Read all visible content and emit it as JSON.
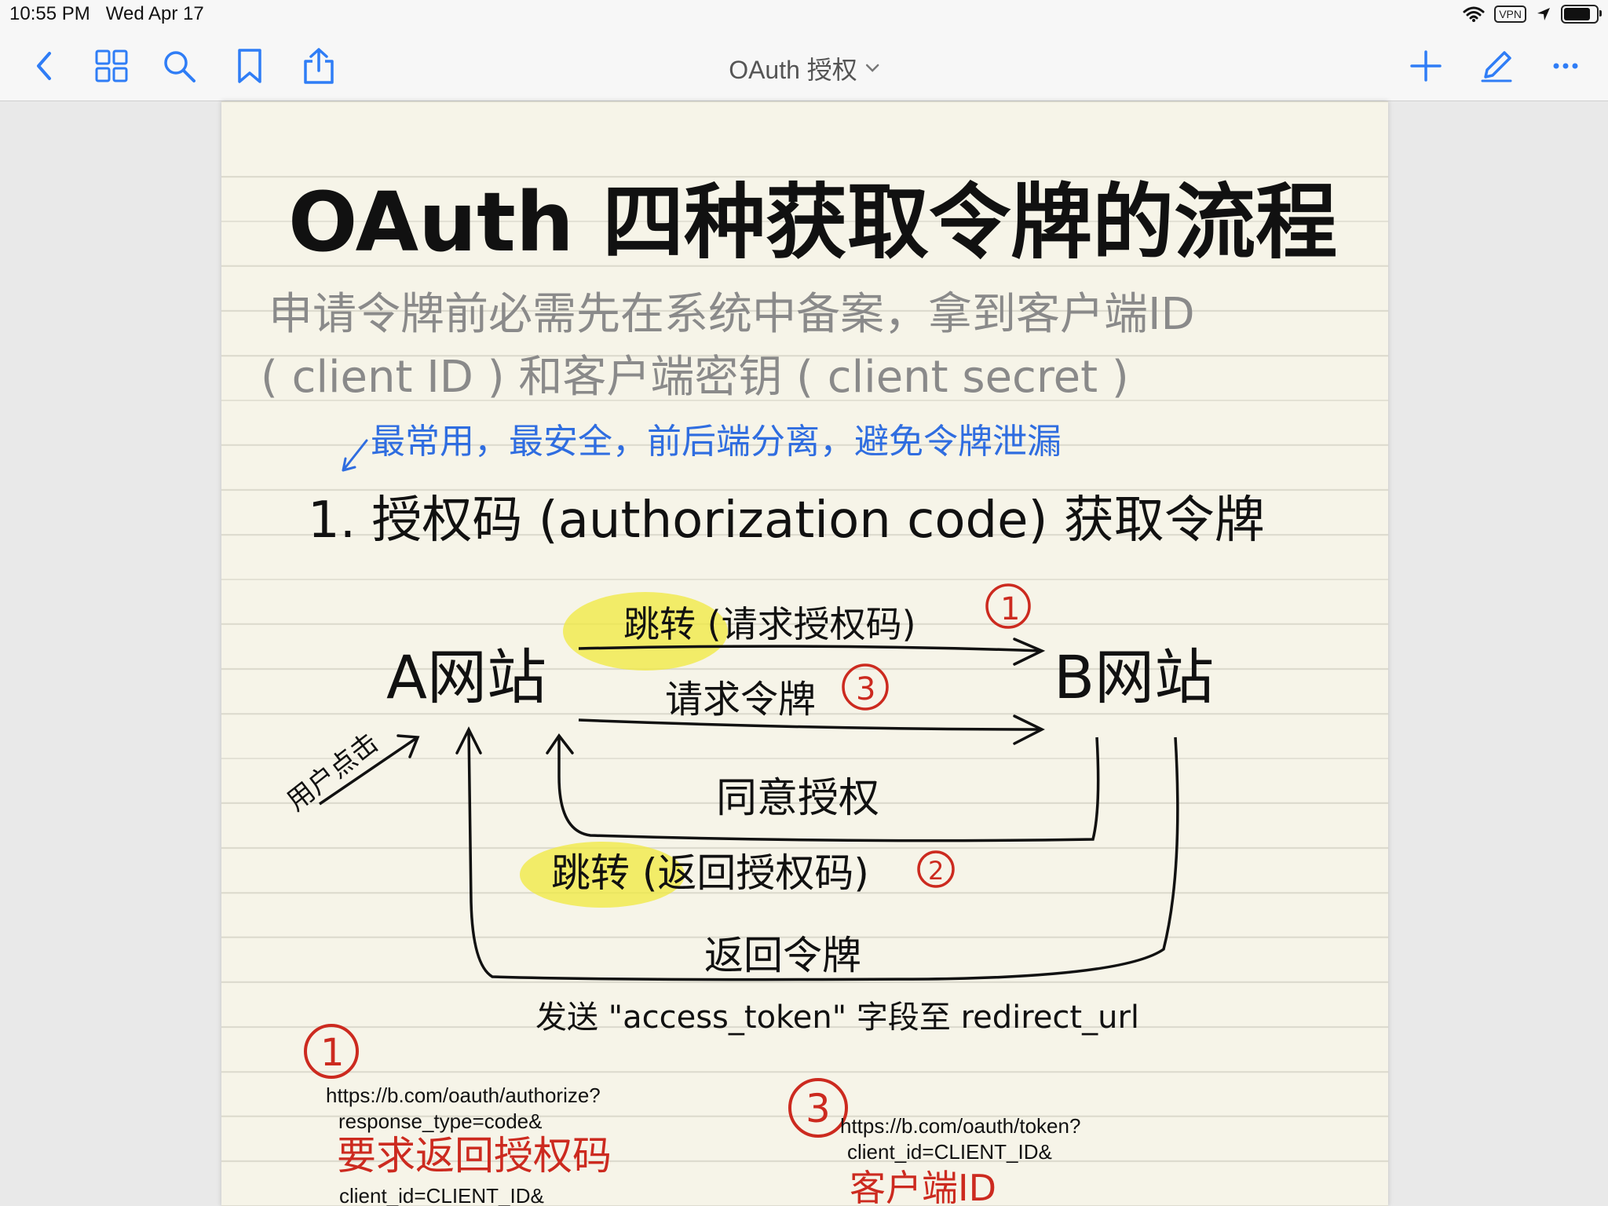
{
  "status_bar": {
    "time": "10:55 PM",
    "date": "Wed Apr 17",
    "vpn": "VPN",
    "battery_level": 0.92
  },
  "nav": {
    "title": "OAuth 授权",
    "icons": [
      "back-chevron-icon",
      "thumbnails-grid-icon",
      "search-icon",
      "bookmark-icon",
      "share-icon",
      "add-icon",
      "pencil-icon",
      "more-icon"
    ]
  },
  "note": {
    "title": "OAuth 四种获取令牌的流程",
    "intro_line1": "申请令牌前必需先在系统中备案，拿到客户端ID",
    "intro_line2": "( client ID ) 和客户端密钥 ( client secret )",
    "annotation": "最常用，最安全，前后端分离，避免令牌泄漏",
    "section1_title": "1. 授权码 (authorization code) 获取令牌",
    "diagram": {
      "node_a": "A网站",
      "node_b": "B网站",
      "user_click": "用户点击",
      "step1_label": "跳转 (请求授权码)",
      "step1_num": "1",
      "step3_label": "请求令牌",
      "step3_num": "3",
      "consent_label": "同意授权",
      "step2_label": "跳转 (返回授权码)",
      "step2_num": "2",
      "return_token": "返回令牌",
      "send_note": "发送 \"access_token\" 字段至 redirect_url"
    },
    "detail1": {
      "num": "1",
      "url": "https://b.com/oauth/authorize?",
      "line2": "response_type=code&",
      "note": "要求返回授权码",
      "line3": "client_id=CLIENT_ID&"
    },
    "detail3": {
      "num": "3",
      "url": "https://b.com/oauth/token?",
      "line2": "client_id=CLIENT_ID&",
      "note": "客户端ID"
    }
  }
}
